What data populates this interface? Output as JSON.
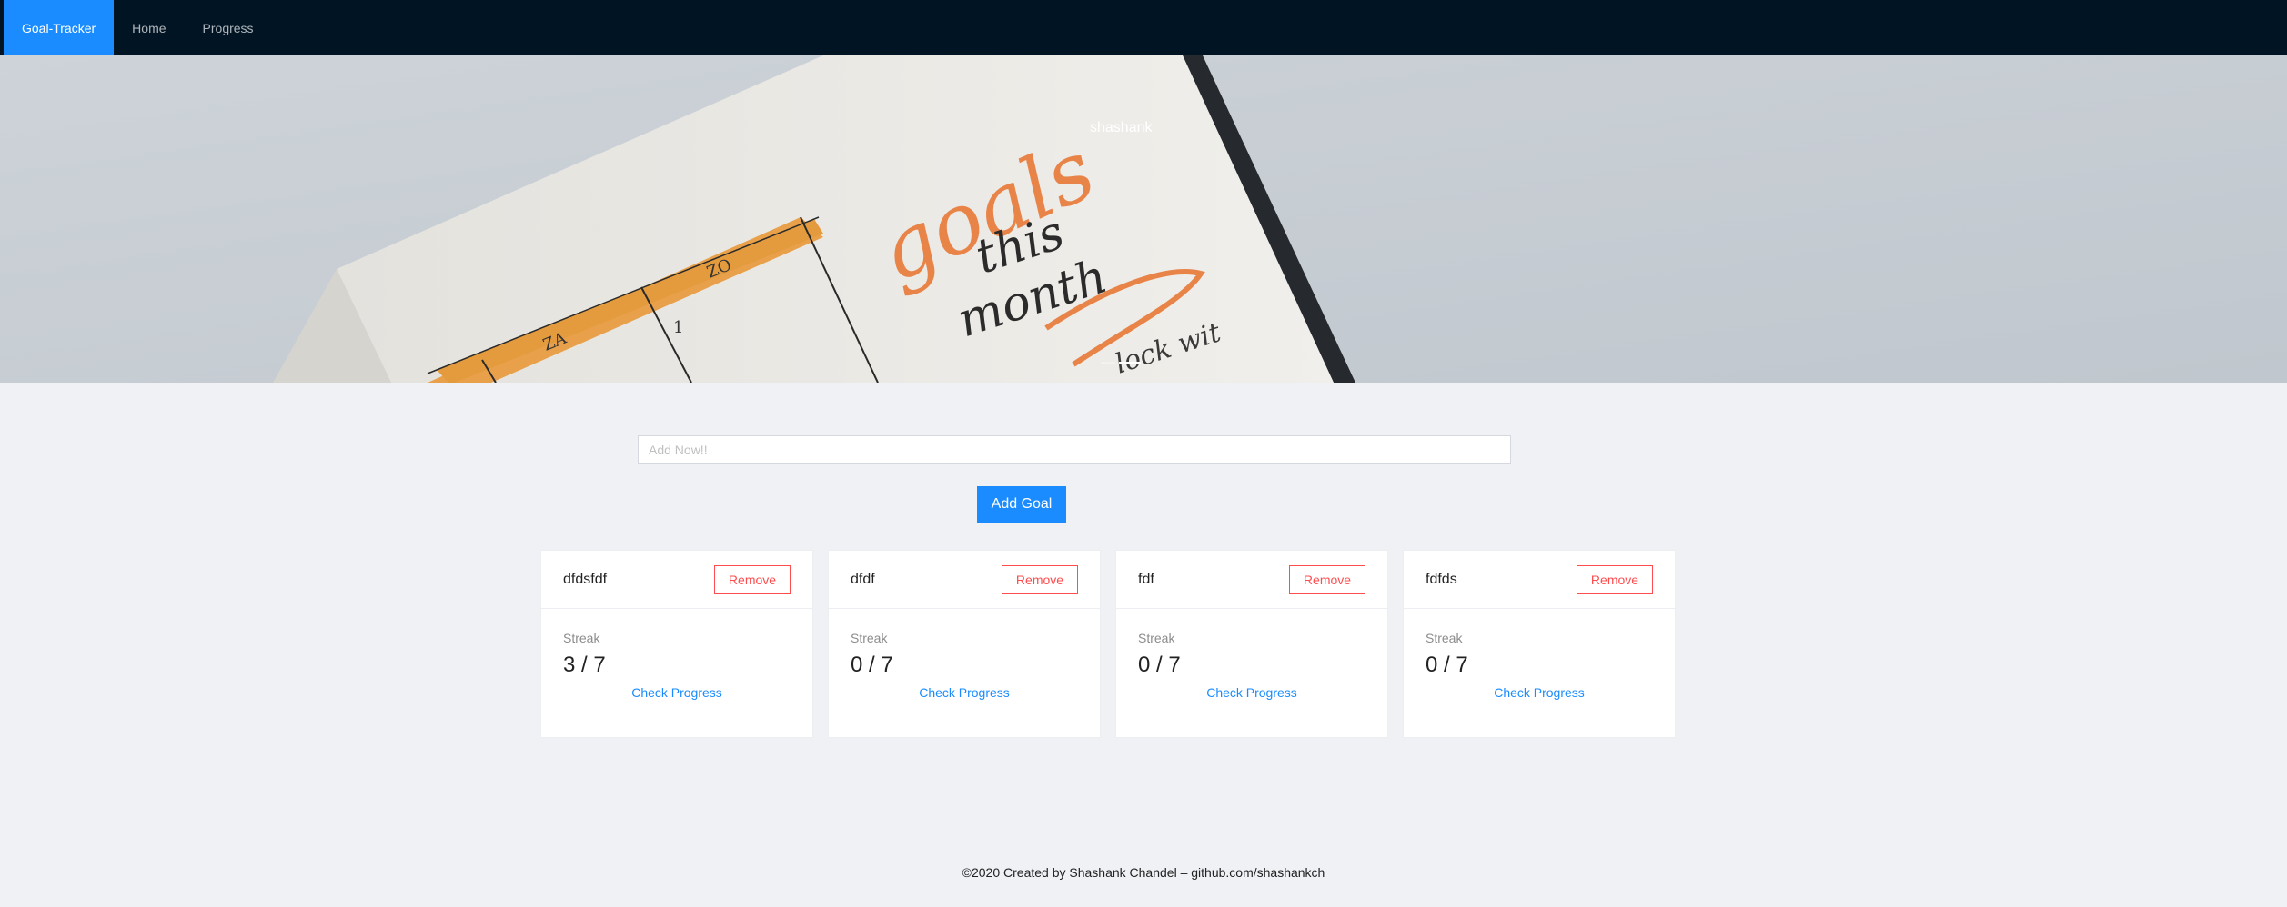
{
  "header": {
    "brand": "Goal-Tracker",
    "nav": [
      {
        "label": "Home"
      },
      {
        "label": "Progress"
      }
    ],
    "background": "#011424",
    "accent": "#1a8cff"
  },
  "hero": {
    "title": "shashank",
    "image_handwriting": [
      "goals",
      "this",
      "month",
      "lock wit"
    ],
    "table_labels": [
      "ZA",
      "ZO",
      "1"
    ],
    "slides": 2,
    "active_slide": 2
  },
  "form": {
    "input_placeholder": "Add Now!!",
    "input_value": "",
    "add_button_label": "Add Goal"
  },
  "goals": [
    {
      "title": "dfdsfdf",
      "remove_label": "Remove",
      "streak_label": "Streak",
      "streak": "3 / 7",
      "link_label": "Check Progress"
    },
    {
      "title": "dfdf",
      "remove_label": "Remove",
      "streak_label": "Streak",
      "streak": "0 / 7",
      "link_label": "Check Progress"
    },
    {
      "title": "fdf",
      "remove_label": "Remove",
      "streak_label": "Streak",
      "streak": "0 / 7",
      "link_label": "Check Progress"
    },
    {
      "title": "fdfds",
      "remove_label": "Remove",
      "streak_label": "Streak",
      "streak": "0 / 7",
      "link_label": "Check Progress"
    }
  ],
  "footer": {
    "text": "©2020 Created by Shashank Chandel – github.com/shashankch"
  },
  "colors": {
    "danger": "#ff4d4f",
    "page_background": "#eff1f5"
  }
}
